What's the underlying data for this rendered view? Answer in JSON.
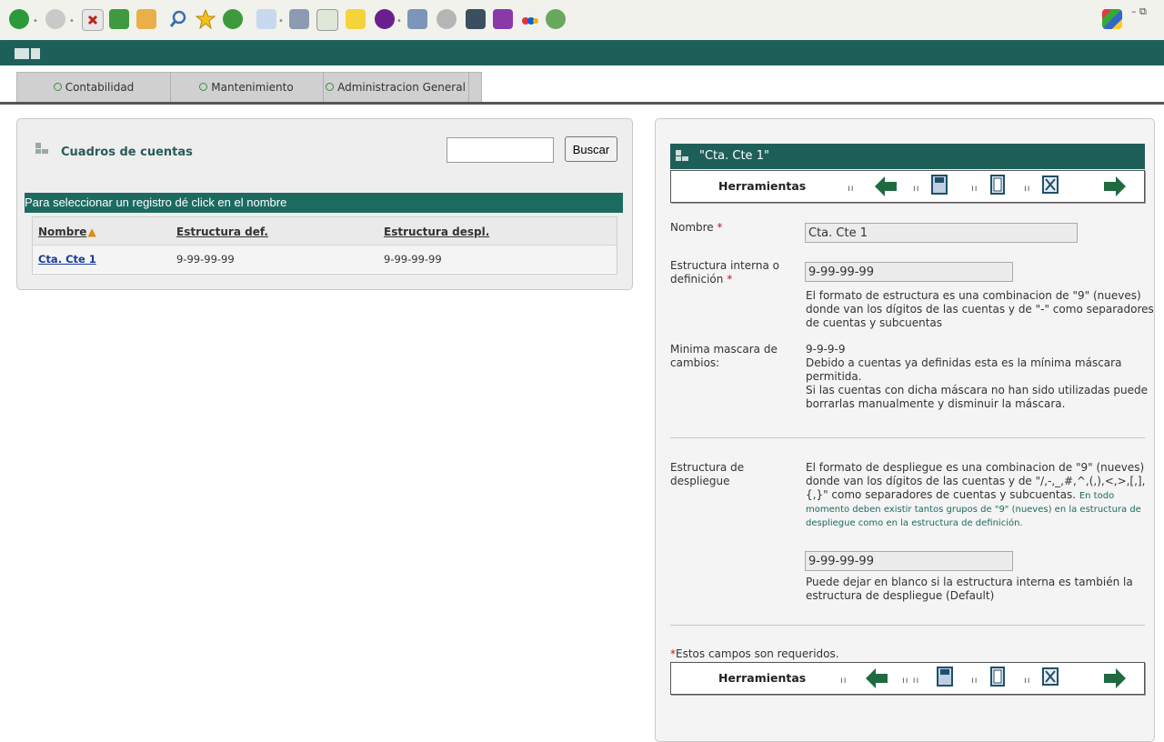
{
  "menu": {
    "items": [
      {
        "label": "Contabilidad"
      },
      {
        "label": "Mantenimiento"
      },
      {
        "label": "Administracion General"
      }
    ]
  },
  "left_panel": {
    "title": "Cuadros de cuentas",
    "search": {
      "value": "",
      "placeholder": "",
      "button": "Buscar"
    },
    "hint": "Para seleccionar un registro dé click en el nombre",
    "table": {
      "columns": [
        "Nombre",
        "Estructura def.",
        "Estructura despl."
      ],
      "rows": [
        [
          "Cta. Cte 1",
          "9-99-99-99",
          "9-99-99-99"
        ]
      ]
    }
  },
  "right_panel": {
    "title": "\"Cta. Cte 1\"",
    "toolbar_label": "Herramientas",
    "fields": {
      "nombre": {
        "label": "Nombre",
        "required": "*",
        "value": "Cta. Cte 1"
      },
      "estructura_interna": {
        "label_line1": "Estructura interna o",
        "label_line2": "definición",
        "required": "*",
        "value": "9-99-99-99",
        "help1": "El formato de estructura es una combinacion de \"9\" (nueves)",
        "help2": "donde van los dígitos de las cuentas y de \"-\" como separadores",
        "help3": "de cuentas y subcuentas"
      },
      "minima_mascara": {
        "label_line1": "Minima mascara de",
        "label_line2": "cambios:",
        "value": "9-9-9-9",
        "help1": "Debido a cuentas ya definidas esta es la mínima máscara",
        "help2": "permitida.",
        "help3": "Si las cuentas con dicha máscara no han sido utilizadas puede",
        "help4": "borrarlas manualmente y disminuir la máscara."
      },
      "estructura_despliegue": {
        "label_line1": "Estructura de",
        "label_line2": "despliegue",
        "help1": "El formato de despliegue es una combinacion de \"9\" (nueves)",
        "help2": "donde van los dígitos de las cuentas y de \"/,-,_,#,^,(,),<,>,[,],",
        "help3": "{,}\" como separadores de cuentas y subcuentas.",
        "note1": "En todo",
        "note2": "momento deben existir tantos grupos de \"9\" (nueves) en la estructura de",
        "note3": "despliegue como en la estructura de definición.",
        "value": "9-99-99-99",
        "help4": "Puede dejar en blanco si la estructura interna es también la",
        "help5": "estructura de despliegue (Default)"
      }
    },
    "required_note": "Estos campos son requeridos.",
    "required_mark": "*"
  }
}
